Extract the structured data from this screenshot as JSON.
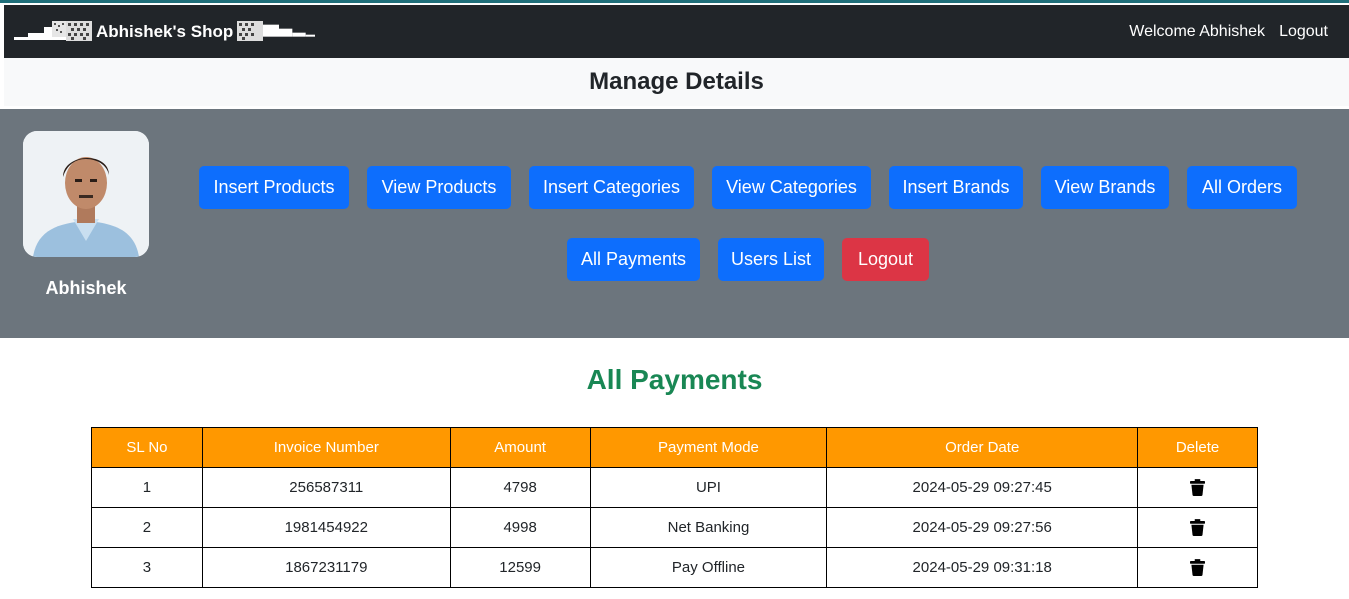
{
  "navbar": {
    "brand": "Abhishek's Shop",
    "welcome": "Welcome Abhishek",
    "logout": "Logout"
  },
  "header": {
    "title": "Manage Details"
  },
  "profile": {
    "name": "Abhishek"
  },
  "admin_buttons": [
    {
      "label": "Insert Products"
    },
    {
      "label": "View Products"
    },
    {
      "label": "Insert Categories"
    },
    {
      "label": "View Categories"
    },
    {
      "label": "Insert Brands"
    },
    {
      "label": "View Brands"
    },
    {
      "label": "All Orders"
    },
    {
      "label": "All Payments"
    },
    {
      "label": "Users List"
    },
    {
      "label": "Logout"
    }
  ],
  "payments": {
    "title": "All Payments",
    "columns": [
      "SL No",
      "Invoice Number",
      "Amount",
      "Payment Mode",
      "Order Date",
      "Delete"
    ],
    "rows": [
      {
        "sl": "1",
        "invoice": "256587311",
        "amount": "4798",
        "mode": "UPI",
        "date": "2024-05-29 09:27:45",
        "delete_icon": "trash-icon"
      },
      {
        "sl": "2",
        "invoice": "1981454922",
        "amount": "4998",
        "mode": "Net Banking",
        "date": "2024-05-29 09:27:56",
        "delete_icon": "trash-icon"
      },
      {
        "sl": "3",
        "invoice": "1867231179",
        "amount": "12599",
        "mode": "Pay Offline",
        "date": "2024-05-29 09:31:18",
        "delete_icon": "trash-icon"
      }
    ]
  },
  "colors": {
    "navbar": "#212529",
    "panel": "#6c757d",
    "primary": "#0d6efd",
    "danger": "#dc3545",
    "success": "#198754",
    "table_header": "#ff9800"
  }
}
